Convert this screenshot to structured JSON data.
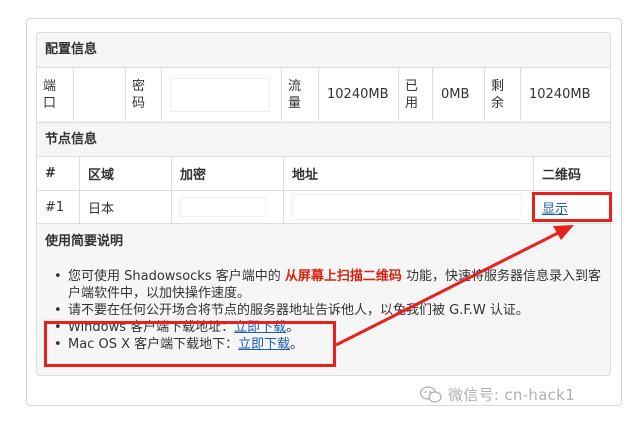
{
  "config": {
    "title": "配置信息",
    "port_label": "端口",
    "password_label": "密码",
    "traffic_label": "流量",
    "traffic_value": "10240MB",
    "used_label": "已用",
    "used_value": "0MB",
    "remaining_label": "剩余",
    "remaining_value": "10240MB"
  },
  "nodes": {
    "title": "节点信息",
    "headers": [
      "#",
      "区域",
      "加密",
      "地址",
      "二维码"
    ],
    "rows": [
      {
        "index": "#1",
        "region": "日本",
        "qr_link": "显示"
      }
    ]
  },
  "usage": {
    "title": "使用简要说明",
    "item1_pre": "您可使用 Shadowsocks 客户端中的",
    "item1_highlight": "从屏幕上扫描二维码",
    "item1_post": "功能，快速将服务器信息录入到客户端软件中，以加快操作速度。",
    "item2": "请不要在任何公开场合将节点的服务器地址告诉他人，以免我们被 G.F.W 认证。",
    "item3_pre": "Windows 客户端下载地址：",
    "item3_link": "立即下载",
    "item3_post": "。",
    "item4_pre": "Mac OS X 客户端下载地下：",
    "item4_link": "立即下载",
    "item4_post": "。"
  },
  "watermark": "微信号: cn-hack1",
  "colors": {
    "highlight_red": "#e8211c",
    "link_blue": "#1a5fb4"
  }
}
